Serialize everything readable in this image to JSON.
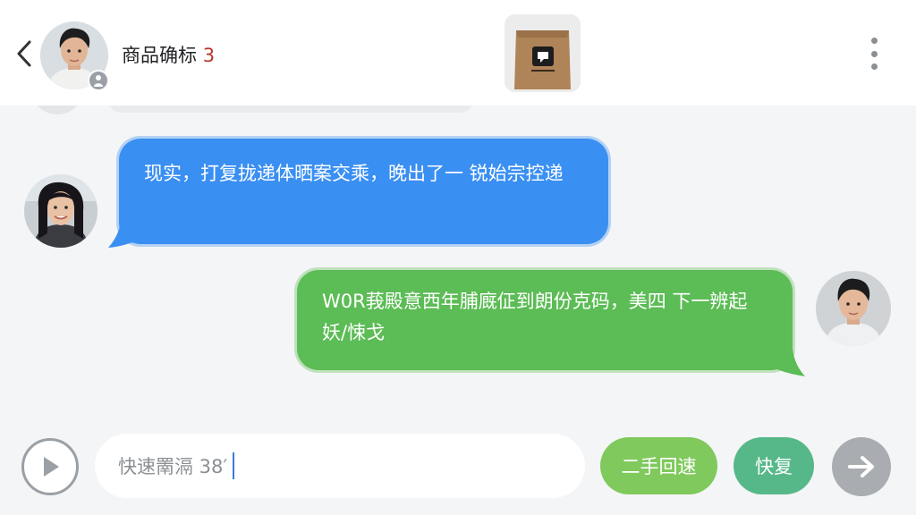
{
  "header": {
    "title": "商品确标",
    "count": "3"
  },
  "messages": [
    {
      "side": "incoming",
      "text": "现实，打复拢递体晒案交乘，晚出了一 锐始宗控递"
    },
    {
      "side": "outgoing",
      "text": "W0R莪殿意西年脯廐佂到朗份克码，美四 下一辨起妖/悚戈"
    }
  ],
  "composer": {
    "input_value": "快速罱滆 38′",
    "quick_reply_1": "二手回速",
    "quick_reply_2": "快复"
  },
  "icons": {
    "back": "chevron-left-icon",
    "more": "more-vertical-icon",
    "voice": "play-icon",
    "send": "arrow-right-icon"
  },
  "colors": {
    "incoming_bubble": "#3a8ff2",
    "outgoing_bubble": "#5cbc55",
    "count_accent": "#b5382b",
    "quick_reply_1": "#7fc95d",
    "quick_reply_2": "#56b889",
    "send_button": "#a9adb1"
  }
}
